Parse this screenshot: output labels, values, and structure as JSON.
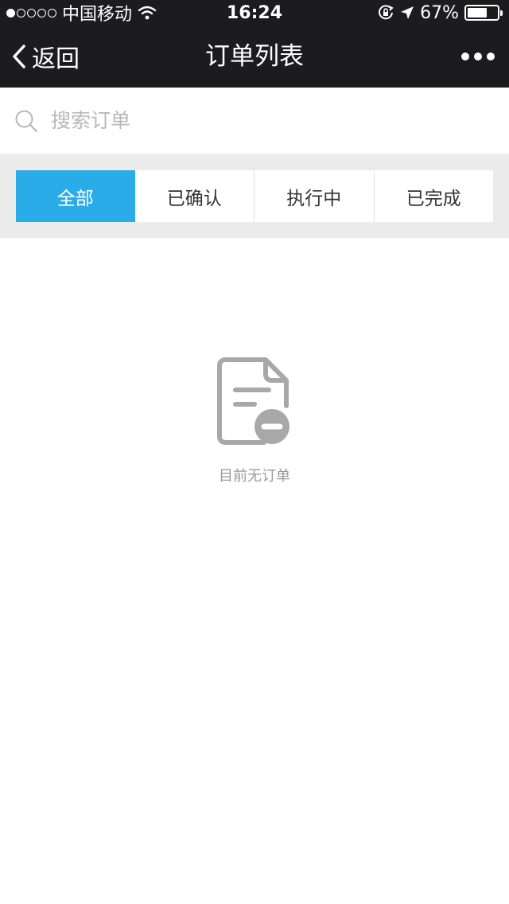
{
  "status_bar": {
    "carrier": "中国移动",
    "time": "16:24",
    "battery_percent": "67%",
    "battery_level": 0.67,
    "signal_bars_filled": 1,
    "signal_bars_total": 5
  },
  "nav": {
    "back_label": "返回",
    "title": "订单列表"
  },
  "search": {
    "placeholder": "搜索订单"
  },
  "tabs": [
    {
      "label": "全部",
      "active": true
    },
    {
      "label": "已确认",
      "active": false
    },
    {
      "label": "执行中",
      "active": false
    },
    {
      "label": "已完成",
      "active": false
    }
  ],
  "empty_state": {
    "message": "目前无订单",
    "icon": "empty-order-document-icon"
  },
  "colors": {
    "header_bg": "#1c1c1e",
    "accent": "#2aace8",
    "tab_area_bg": "#ebebeb",
    "empty_icon": "#a8a8a8"
  }
}
